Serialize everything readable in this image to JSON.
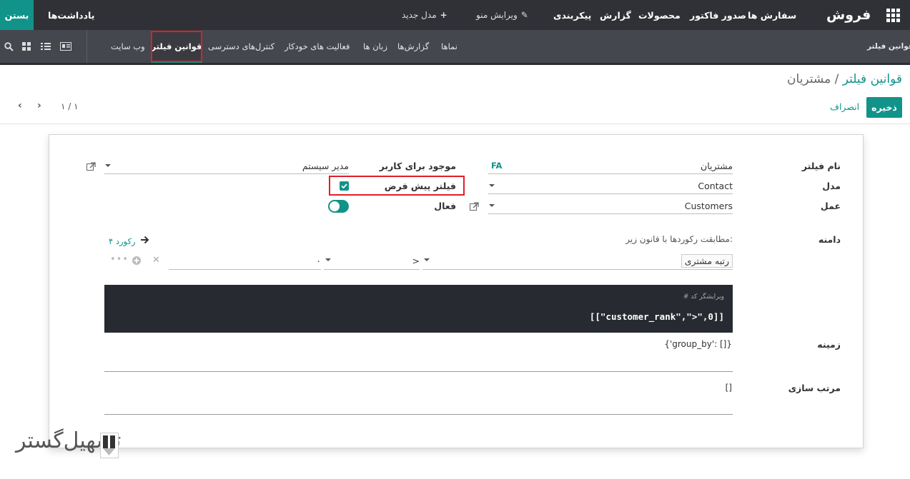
{
  "topbar": {
    "brand": "فروش",
    "menu": [
      "سفارش ها",
      "صدور فاکتور",
      "محصولات",
      "گزارش",
      "پیکربندی"
    ],
    "edit_menu": "ویرایش منو",
    "new_model": "مدل جدید",
    "notes": "یادداشت‌ها",
    "close": "بستن"
  },
  "subbar": {
    "title": "قوانین فیلتر",
    "tabs": [
      "وب سایت",
      "قوانین فیلتر",
      "کنترل‌های دسترسی",
      "فعالیت های خودکار",
      "زبان ها",
      "گزارش‌ها",
      "نماها"
    ],
    "active_index": 1
  },
  "breadcrumb": {
    "parent": "قوانین فیلتر",
    "separator": "/",
    "current": "مشتریان"
  },
  "controls": {
    "save": "ذخیره",
    "discard": "انصراف",
    "pager": "۱ / ۱"
  },
  "form": {
    "filter_name_label": "نام فیلتر",
    "filter_name_value": "مشتریان",
    "lang_tag": "FA",
    "model_label": "مدل",
    "model_value": "Contact",
    "action_label": "عمل",
    "action_value": "Customers",
    "user_label": "موجود برای کاربر",
    "user_value": "مدیر سیستم",
    "default_filter_label": "فیلتر پیش فرض",
    "default_filter_checked": true,
    "active_label": "فعال",
    "active_on": true,
    "domain_label": "دامنه",
    "domain_rule_text": "مطابقت رکوردها با قانون زیر:",
    "records_count": "۴ رکورد",
    "domain_field": "رتبه مشتری",
    "domain_operator": ">",
    "domain_value": "۰",
    "code_comment": "# ویرایشگر کد",
    "code_text": "[[\"customer_rank\",\">\",0]]",
    "context_label": "زمینه",
    "context_value": "{'group_by': []}",
    "sort_label": "مرتب سازی",
    "sort_value": "[]"
  },
  "watermark": "تسهیل‌گستر",
  "colors": {
    "accent": "#12938a",
    "topbar": "#2f3136",
    "subbar": "#44474e",
    "highlight": "#e01e2a"
  }
}
